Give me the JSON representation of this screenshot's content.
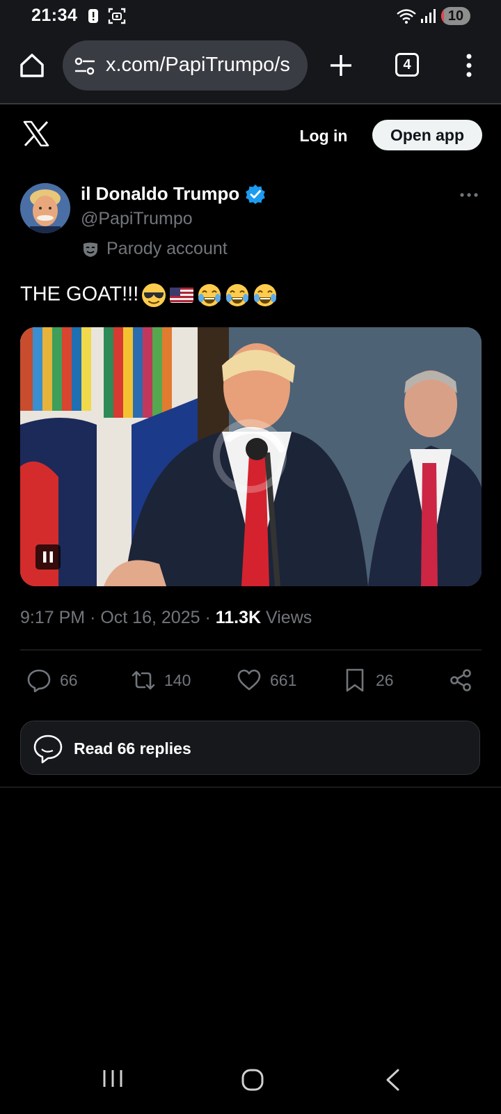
{
  "status_bar": {
    "time": "21:34",
    "battery_level": "10",
    "battery_fraction": 0.1,
    "icons": [
      "alert-icon",
      "screen-capture-icon",
      "wifi-icon",
      "signal-icon",
      "battery-icon"
    ]
  },
  "browser": {
    "url": "x.com/PapiTrumpo/s",
    "tab_count": "4",
    "icons": [
      "home-icon",
      "site-settings-icon",
      "new-tab-plus-icon",
      "tabs-icon",
      "more-vertical-icon"
    ]
  },
  "x_header": {
    "login_label": "Log in",
    "open_app_label": "Open app",
    "icons": [
      "x-logo-icon"
    ]
  },
  "tweet": {
    "author_name": "il Donaldo Trumpo",
    "handle": "@PapiTrumpo",
    "parody_label": "Parody account",
    "text": "THE GOAT!!!",
    "emojis": [
      "sunglasses-emoji",
      "us-flag-emoji",
      "tears-of-joy-emoji",
      "tears-of-joy-emoji",
      "tears-of-joy-emoji"
    ],
    "time": "9:17 PM",
    "date": "Oct 16, 2025",
    "separator": "·",
    "views_count": "11.3K",
    "views_label": "Views",
    "stats": {
      "replies": "66",
      "retweets": "140",
      "likes": "661",
      "bookmarks": "26"
    },
    "read_replies_label": "Read 66 replies"
  },
  "colors": {
    "background": "#000000",
    "text_primary": "#e7e9ea",
    "text_secondary": "#71767b",
    "verified_blue": "#1d9bf0",
    "browser_chrome": "#16171b"
  }
}
